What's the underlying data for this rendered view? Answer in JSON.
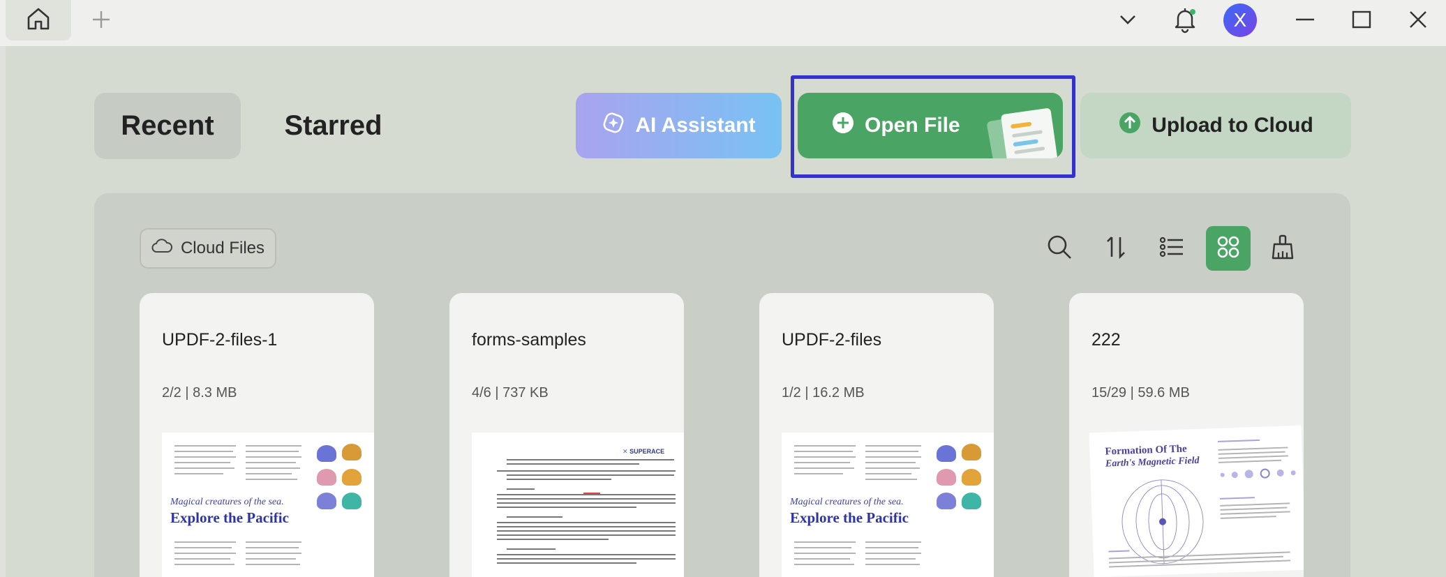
{
  "tabs": {
    "recent": "Recent",
    "starred": "Starred"
  },
  "actions": {
    "ai_assistant": "AI Assistant",
    "open_file": "Open File",
    "upload": "Upload to Cloud"
  },
  "user": {
    "avatar_letter": "X"
  },
  "cloud_files": "Cloud Files",
  "files": [
    {
      "name": "UPDF-2-files-1",
      "meta": "2/2 | 8.3 MB",
      "thumb_title1": "Magical creatures of the sea.",
      "thumb_title2": "Explore the Pacific"
    },
    {
      "name": "forms-samples",
      "meta": "4/6 | 737 KB",
      "thumb_brand": "SUPERACE"
    },
    {
      "name": "UPDF-2-files",
      "meta": "1/2 | 16.2 MB",
      "thumb_title1": "Magical creatures of the sea.",
      "thumb_title2": "Explore the Pacific"
    },
    {
      "name": "222",
      "meta": "15/29 | 59.6 MB",
      "thumb_title1": "Formation Of The",
      "thumb_title2": "Earth's Magnetic Field"
    }
  ],
  "colors": {
    "accent_green": "#4aa565",
    "highlight_outline": "#3332c9",
    "avatar": "#4a5af0"
  }
}
